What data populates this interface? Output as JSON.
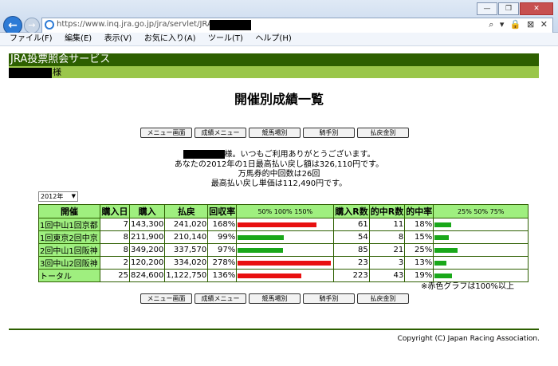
{
  "browser": {
    "url": "https://www.inq.jra.go.jp/jra/servlet/JRAWe",
    "tool_icons": "⌕ ▾ 🔒 ⊠ ✕",
    "window_buttons": [
      "—",
      "❐",
      "✕"
    ]
  },
  "menu": [
    "ファイル(F)",
    "編集(E)",
    "表示(V)",
    "お気に入り(A)",
    "ツール(T)",
    "ヘルプ(H)"
  ],
  "header": {
    "service_name": "JRA投票照会サービス",
    "user_suffix": "様"
  },
  "page_title": "開催別成績一覧",
  "nav_buttons": [
    "メニュー画面",
    "成績メニュー",
    "競馬場別",
    "騎手別",
    "払戻金別"
  ],
  "greeting": {
    "line1_suffix": "様。いつもご利用ありがとうございます。",
    "line2": "あなたの2012年の1日最高払い戻し額は326,110円です。",
    "line3": "万馬券的中回数は26回",
    "line4": "最高払い戻し単価は112,490円です。"
  },
  "year_select": "2012年",
  "table": {
    "headers": [
      "開催",
      "購入日",
      "購入",
      "払戻",
      "回収率",
      "購入R数",
      "的中R数",
      "的中率"
    ],
    "return_scale": "50%   100%   150%",
    "hit_scale": "25%   50%   75%",
    "rows": [
      {
        "name": "1回中山1回京都",
        "days": "7",
        "purchase": "143,300",
        "payout": "241,020",
        "rate": "168%",
        "races": "61",
        "hits": "11",
        "hit_rate": "18%",
        "rate_value": 168,
        "hit_value": 18
      },
      {
        "name": "1回東京2回中京",
        "days": "8",
        "purchase": "211,900",
        "payout": "210,140",
        "rate": "99%",
        "races": "54",
        "hits": "8",
        "hit_rate": "15%",
        "rate_value": 99,
        "hit_value": 15
      },
      {
        "name": "2回中山1回阪神",
        "days": "8",
        "purchase": "349,200",
        "payout": "337,570",
        "rate": "97%",
        "races": "85",
        "hits": "21",
        "hit_rate": "25%",
        "rate_value": 97,
        "hit_value": 25
      },
      {
        "name": "3回中山2回阪神",
        "days": "2",
        "purchase": "120,200",
        "payout": "334,020",
        "rate": "278%",
        "races": "23",
        "hits": "3",
        "hit_rate": "13%",
        "rate_value": 278,
        "hit_value": 13
      },
      {
        "name": "トータル",
        "days": "25",
        "purchase": "824,600",
        "payout": "1,122,750",
        "rate": "136%",
        "races": "223",
        "hits": "43",
        "hit_rate": "19%",
        "rate_value": 136,
        "hit_value": 19
      }
    ]
  },
  "note": "※赤色グラフは100%以上",
  "colors": {
    "dark_green": "#2d5f00",
    "light_green": "#9ac64a",
    "table_green": "#9fef7f",
    "bar_red": "#e81010",
    "bar_green": "#1aa81a"
  },
  "copyright": "Copyright (C) Japan Racing Association."
}
